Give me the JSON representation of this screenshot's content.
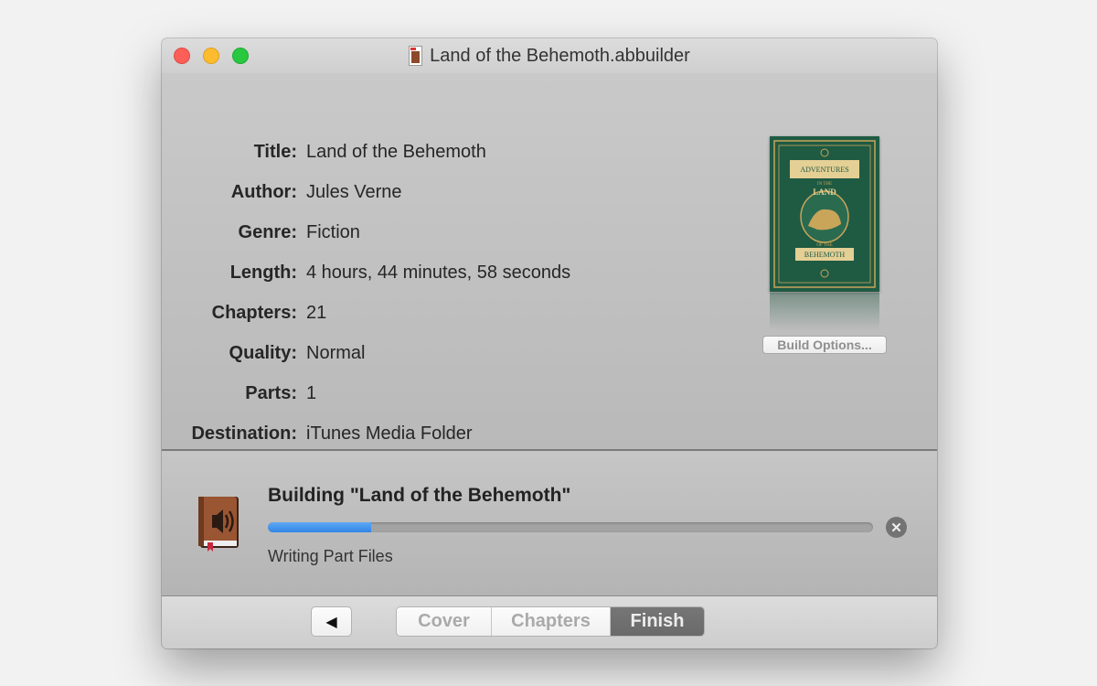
{
  "window": {
    "title": "Land of the Behemoth.abbuilder",
    "controls": [
      "close",
      "minimize",
      "zoom"
    ]
  },
  "info": {
    "rows": [
      {
        "label": "Title:",
        "value": "Land of the Behemoth"
      },
      {
        "label": "Author:",
        "value": "Jules Verne"
      },
      {
        "label": "Genre:",
        "value": "Fiction"
      },
      {
        "label": "Length:",
        "value": "4 hours, 44 minutes, 58 seconds"
      },
      {
        "label": "Chapters:",
        "value": "21"
      },
      {
        "label": "Quality:",
        "value": "Normal"
      },
      {
        "label": "Parts:",
        "value": "1"
      },
      {
        "label": "Destination:",
        "value": "iTunes Media Folder"
      }
    ],
    "cover_art": {
      "lines": [
        "ADVENTURES",
        "IN THE",
        "LAND",
        "OF THE",
        "BEHEMOTH"
      ],
      "color": "#1f5a43",
      "accent": "#c9a55a"
    },
    "build_options_label": "Build Options..."
  },
  "progress": {
    "title": "Building \"Land of the Behemoth\"",
    "status": "Writing Part Files",
    "fraction": 0.17,
    "icon": "audiobook-icon",
    "cancel_icon": "cancel-x-icon"
  },
  "nav": {
    "back_icon": "triangle-left-icon",
    "steps": [
      "Cover",
      "Chapters",
      "Finish"
    ],
    "active": "Finish"
  }
}
